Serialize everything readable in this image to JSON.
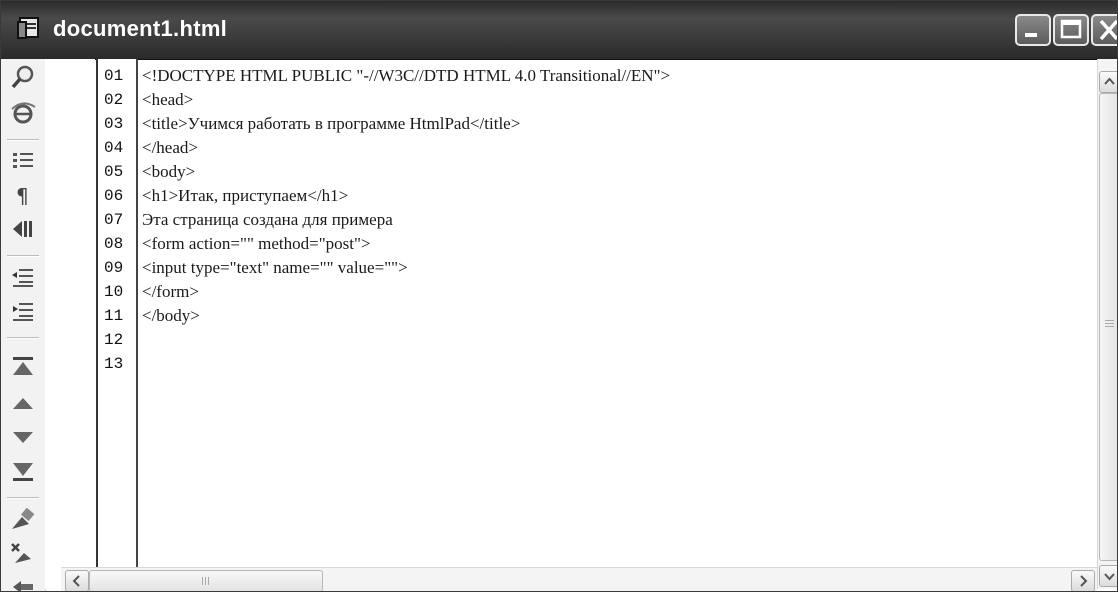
{
  "window": {
    "title": "document1.html"
  },
  "toolbar": {
    "icons": [
      "search-icon",
      "browser-preview-icon",
      "line-numbers-icon",
      "paragraph-icon",
      "show-marks-icon",
      "indent-left-icon",
      "indent-right-icon",
      "go-top-icon",
      "go-up-icon",
      "go-down-icon",
      "go-bottom-icon",
      "bookmark-icon",
      "clear-bookmark-icon",
      "next-bookmark-icon"
    ]
  },
  "editor": {
    "line_numbers": [
      "01",
      "02",
      "03",
      "04",
      "05",
      "06",
      "07",
      "08",
      "09",
      "10",
      "11",
      "12",
      "13"
    ],
    "lines": [
      "<!DOCTYPE HTML PUBLIC \"-//W3C//DTD HTML 4.0 Transitional//EN\">",
      "<head>",
      "<title>Учимся работать в программе HtmlPad</title>",
      "</head>",
      "<body>",
      "<h1>Итак, приступаем</h1>",
      "Эта страница создана для примера",
      "<form action=\"\" method=\"post\">",
      "<input type=\"text\" name=\"\" value=\"\">",
      "</form>",
      "</body>",
      "",
      ""
    ]
  },
  "colors": {
    "title_bar": "#2b2b2b",
    "title_text": "#ffffff",
    "code_text": "#1a1a1a"
  }
}
